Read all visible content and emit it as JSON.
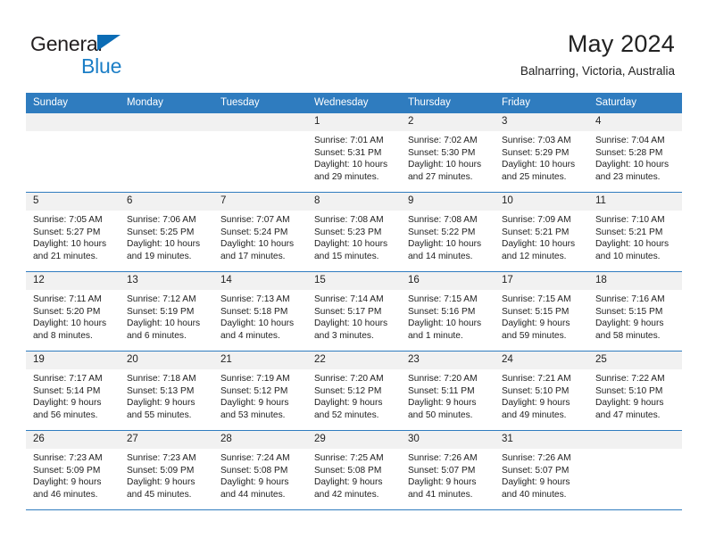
{
  "brand": {
    "name_part1": "General",
    "name_part2": "Blue",
    "logo_icon": "triangle-icon"
  },
  "header": {
    "title": "May 2024",
    "subtitle": "Balnarring, Victoria, Australia"
  },
  "colors": {
    "header_blue": "#2f7cbf",
    "brand_blue": "#1b7ec6",
    "daynum_band": "#f1f1f1",
    "text": "#222222"
  },
  "weekday_headers": [
    "Sunday",
    "Monday",
    "Tuesday",
    "Wednesday",
    "Thursday",
    "Friday",
    "Saturday"
  ],
  "labels": {
    "sunrise_prefix": "Sunrise:",
    "sunset_prefix": "Sunset:",
    "daylight_prefix": "Daylight:"
  },
  "weeks": [
    [
      {
        "day": "",
        "empty": true
      },
      {
        "day": "",
        "empty": true
      },
      {
        "day": "",
        "empty": true
      },
      {
        "day": "1",
        "sunrise": "Sunrise: 7:01 AM",
        "sunset": "Sunset: 5:31 PM",
        "daylight": "Daylight: 10 hours and 29 minutes."
      },
      {
        "day": "2",
        "sunrise": "Sunrise: 7:02 AM",
        "sunset": "Sunset: 5:30 PM",
        "daylight": "Daylight: 10 hours and 27 minutes."
      },
      {
        "day": "3",
        "sunrise": "Sunrise: 7:03 AM",
        "sunset": "Sunset: 5:29 PM",
        "daylight": "Daylight: 10 hours and 25 minutes."
      },
      {
        "day": "4",
        "sunrise": "Sunrise: 7:04 AM",
        "sunset": "Sunset: 5:28 PM",
        "daylight": "Daylight: 10 hours and 23 minutes."
      }
    ],
    [
      {
        "day": "5",
        "sunrise": "Sunrise: 7:05 AM",
        "sunset": "Sunset: 5:27 PM",
        "daylight": "Daylight: 10 hours and 21 minutes."
      },
      {
        "day": "6",
        "sunrise": "Sunrise: 7:06 AM",
        "sunset": "Sunset: 5:25 PM",
        "daylight": "Daylight: 10 hours and 19 minutes."
      },
      {
        "day": "7",
        "sunrise": "Sunrise: 7:07 AM",
        "sunset": "Sunset: 5:24 PM",
        "daylight": "Daylight: 10 hours and 17 minutes."
      },
      {
        "day": "8",
        "sunrise": "Sunrise: 7:08 AM",
        "sunset": "Sunset: 5:23 PM",
        "daylight": "Daylight: 10 hours and 15 minutes."
      },
      {
        "day": "9",
        "sunrise": "Sunrise: 7:08 AM",
        "sunset": "Sunset: 5:22 PM",
        "daylight": "Daylight: 10 hours and 14 minutes."
      },
      {
        "day": "10",
        "sunrise": "Sunrise: 7:09 AM",
        "sunset": "Sunset: 5:21 PM",
        "daylight": "Daylight: 10 hours and 12 minutes."
      },
      {
        "day": "11",
        "sunrise": "Sunrise: 7:10 AM",
        "sunset": "Sunset: 5:21 PM",
        "daylight": "Daylight: 10 hours and 10 minutes."
      }
    ],
    [
      {
        "day": "12",
        "sunrise": "Sunrise: 7:11 AM",
        "sunset": "Sunset: 5:20 PM",
        "daylight": "Daylight: 10 hours and 8 minutes."
      },
      {
        "day": "13",
        "sunrise": "Sunrise: 7:12 AM",
        "sunset": "Sunset: 5:19 PM",
        "daylight": "Daylight: 10 hours and 6 minutes."
      },
      {
        "day": "14",
        "sunrise": "Sunrise: 7:13 AM",
        "sunset": "Sunset: 5:18 PM",
        "daylight": "Daylight: 10 hours and 4 minutes."
      },
      {
        "day": "15",
        "sunrise": "Sunrise: 7:14 AM",
        "sunset": "Sunset: 5:17 PM",
        "daylight": "Daylight: 10 hours and 3 minutes."
      },
      {
        "day": "16",
        "sunrise": "Sunrise: 7:15 AM",
        "sunset": "Sunset: 5:16 PM",
        "daylight": "Daylight: 10 hours and 1 minute."
      },
      {
        "day": "17",
        "sunrise": "Sunrise: 7:15 AM",
        "sunset": "Sunset: 5:15 PM",
        "daylight": "Daylight: 9 hours and 59 minutes."
      },
      {
        "day": "18",
        "sunrise": "Sunrise: 7:16 AM",
        "sunset": "Sunset: 5:15 PM",
        "daylight": "Daylight: 9 hours and 58 minutes."
      }
    ],
    [
      {
        "day": "19",
        "sunrise": "Sunrise: 7:17 AM",
        "sunset": "Sunset: 5:14 PM",
        "daylight": "Daylight: 9 hours and 56 minutes."
      },
      {
        "day": "20",
        "sunrise": "Sunrise: 7:18 AM",
        "sunset": "Sunset: 5:13 PM",
        "daylight": "Daylight: 9 hours and 55 minutes."
      },
      {
        "day": "21",
        "sunrise": "Sunrise: 7:19 AM",
        "sunset": "Sunset: 5:12 PM",
        "daylight": "Daylight: 9 hours and 53 minutes."
      },
      {
        "day": "22",
        "sunrise": "Sunrise: 7:20 AM",
        "sunset": "Sunset: 5:12 PM",
        "daylight": "Daylight: 9 hours and 52 minutes."
      },
      {
        "day": "23",
        "sunrise": "Sunrise: 7:20 AM",
        "sunset": "Sunset: 5:11 PM",
        "daylight": "Daylight: 9 hours and 50 minutes."
      },
      {
        "day": "24",
        "sunrise": "Sunrise: 7:21 AM",
        "sunset": "Sunset: 5:10 PM",
        "daylight": "Daylight: 9 hours and 49 minutes."
      },
      {
        "day": "25",
        "sunrise": "Sunrise: 7:22 AM",
        "sunset": "Sunset: 5:10 PM",
        "daylight": "Daylight: 9 hours and 47 minutes."
      }
    ],
    [
      {
        "day": "26",
        "sunrise": "Sunrise: 7:23 AM",
        "sunset": "Sunset: 5:09 PM",
        "daylight": "Daylight: 9 hours and 46 minutes."
      },
      {
        "day": "27",
        "sunrise": "Sunrise: 7:23 AM",
        "sunset": "Sunset: 5:09 PM",
        "daylight": "Daylight: 9 hours and 45 minutes."
      },
      {
        "day": "28",
        "sunrise": "Sunrise: 7:24 AM",
        "sunset": "Sunset: 5:08 PM",
        "daylight": "Daylight: 9 hours and 44 minutes."
      },
      {
        "day": "29",
        "sunrise": "Sunrise: 7:25 AM",
        "sunset": "Sunset: 5:08 PM",
        "daylight": "Daylight: 9 hours and 42 minutes."
      },
      {
        "day": "30",
        "sunrise": "Sunrise: 7:26 AM",
        "sunset": "Sunset: 5:07 PM",
        "daylight": "Daylight: 9 hours and 41 minutes."
      },
      {
        "day": "31",
        "sunrise": "Sunrise: 7:26 AM",
        "sunset": "Sunset: 5:07 PM",
        "daylight": "Daylight: 9 hours and 40 minutes."
      },
      {
        "day": "",
        "empty": true
      }
    ]
  ]
}
